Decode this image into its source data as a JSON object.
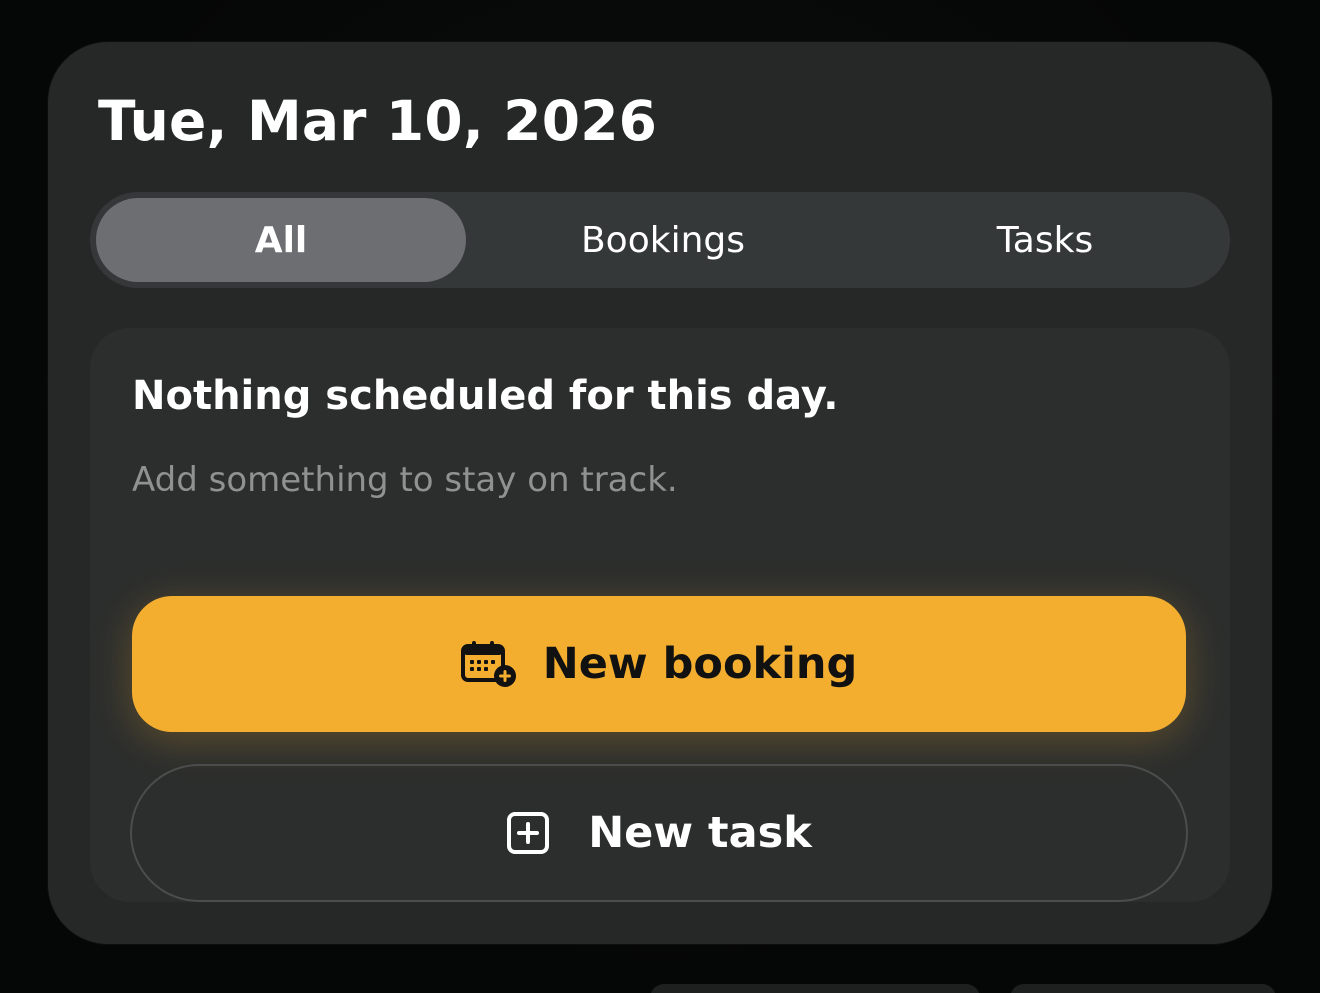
{
  "header": {
    "date_title": "Tue, Mar 10, 2026"
  },
  "filter": {
    "tabs": [
      {
        "label": "All",
        "selected": true
      },
      {
        "label": "Bookings",
        "selected": false
      },
      {
        "label": "Tasks",
        "selected": false
      }
    ]
  },
  "empty_state": {
    "title": "Nothing scheduled for this day.",
    "subtitle": "Add something to stay on track."
  },
  "actions": {
    "new_booking": {
      "label": "New booking",
      "icon": "calendar-plus-icon"
    },
    "new_task": {
      "label": "New task",
      "icon": "square-plus-icon"
    }
  },
  "colors": {
    "accent": "#F3AE30",
    "card_bg": "#262827",
    "panel_bg": "#2C2E2D",
    "segment_bg": "#353839",
    "segment_active": "#6C6E72"
  }
}
